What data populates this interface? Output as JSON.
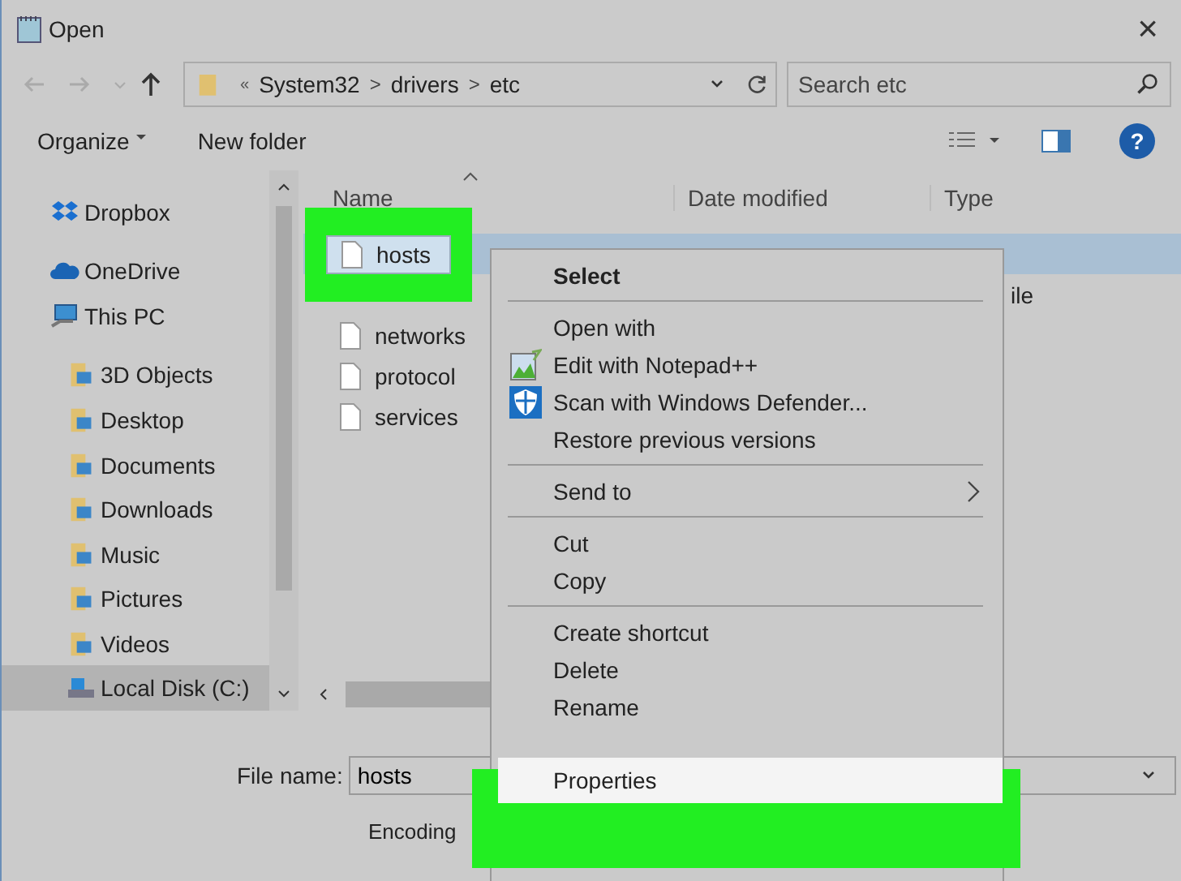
{
  "window": {
    "title": "Open",
    "close": "×"
  },
  "address": {
    "prefix": "«",
    "crumbs": [
      "System32",
      "drivers",
      "etc"
    ],
    "separator": ">"
  },
  "search": {
    "placeholder": "Search etc"
  },
  "toolbar": {
    "organize": "Organize",
    "new_folder": "New folder",
    "help": "?"
  },
  "sidebar": {
    "items": [
      {
        "label": "Dropbox",
        "kind": "dropbox",
        "selected": false
      },
      {
        "label": "OneDrive",
        "kind": "cloud",
        "selected": false
      },
      {
        "label": "This PC",
        "kind": "pc",
        "selected": false,
        "children": [
          {
            "label": "3D Objects",
            "kind": "folder",
            "selected": false
          },
          {
            "label": "Desktop",
            "kind": "folder",
            "selected": false
          },
          {
            "label": "Documents",
            "kind": "folder",
            "selected": false
          },
          {
            "label": "Downloads",
            "kind": "folder",
            "selected": false
          },
          {
            "label": "Music",
            "kind": "folder",
            "selected": false
          },
          {
            "label": "Pictures",
            "kind": "folder",
            "selected": false
          },
          {
            "label": "Videos",
            "kind": "folder",
            "selected": false
          },
          {
            "label": "Local Disk (C:)",
            "kind": "drive",
            "selected": true
          }
        ]
      }
    ]
  },
  "table": {
    "columns": [
      "Name",
      "Date modified",
      "Type"
    ],
    "rows": [
      {
        "name": "hosts",
        "selected": true
      },
      {
        "type": "ile",
        "selected": false
      },
      {
        "name": "networks",
        "selected": false
      },
      {
        "name": "protocol",
        "selected": false
      },
      {
        "name": "services",
        "selected": false
      }
    ]
  },
  "file_name": {
    "label": "File name:",
    "value": "hosts"
  },
  "encoding": {
    "label": "Encoding"
  },
  "context_menu": {
    "items": [
      {
        "label": "Select",
        "kind": "bold",
        "selected": false
      },
      {
        "kind": "separator"
      },
      {
        "label": "Open with",
        "kind": "plain",
        "selected": false
      },
      {
        "label": "Edit with Notepad++",
        "kind": "notepad",
        "selected": false
      },
      {
        "label": "Scan with Windows Defender...",
        "kind": "shield",
        "selected": false
      },
      {
        "label": "Restore previous versions",
        "kind": "plain",
        "selected": false
      },
      {
        "kind": "separator"
      },
      {
        "label": "Send to",
        "kind": "submenu",
        "selected": false
      },
      {
        "kind": "separator"
      },
      {
        "label": "Cut",
        "kind": "plain",
        "selected": false
      },
      {
        "label": "Copy",
        "kind": "plain",
        "selected": false
      },
      {
        "kind": "separator"
      },
      {
        "label": "Create shortcut",
        "kind": "plain",
        "selected": false
      },
      {
        "label": "Delete",
        "kind": "plain",
        "selected": false
      },
      {
        "label": "Rename",
        "kind": "plain",
        "selected": false
      },
      {
        "label": "Properties",
        "kind": "plain",
        "selected": true
      }
    ]
  }
}
